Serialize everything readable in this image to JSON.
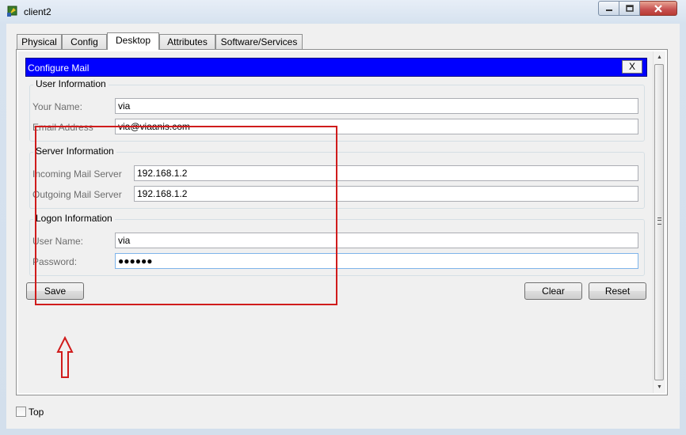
{
  "window": {
    "title": "client2",
    "controls": {
      "minimize": "minimize-icon",
      "maximize": "maximize-icon",
      "close": "close-icon"
    }
  },
  "tabs": [
    {
      "label": "Physical",
      "active": false
    },
    {
      "label": "Config",
      "active": false
    },
    {
      "label": "Desktop",
      "active": true
    },
    {
      "label": "Attributes",
      "active": false
    },
    {
      "label": "Software/Services",
      "active": false
    }
  ],
  "mail": {
    "header_title": "Configure Mail",
    "close_label": "X",
    "user_info": {
      "title": "User Information",
      "name_label": "Your Name:",
      "name_value": "via",
      "email_label": "Email Address",
      "email_value": "via@viaanis.com"
    },
    "server_info": {
      "title": "Server Information",
      "incoming_label": "Incoming Mail Server",
      "incoming_value": "192.168.1.2",
      "outgoing_label": "Outgoing Mail Server",
      "outgoing_value": "192.168.1.2"
    },
    "logon_info": {
      "title": "Logon Information",
      "username_label": "User Name:",
      "username_value": "via",
      "password_label": "Password:",
      "password_value": "●●●●●●"
    },
    "buttons": {
      "save": "Save",
      "clear": "Clear",
      "reset": "Reset"
    }
  },
  "footer": {
    "top_label": "Top",
    "top_checked": false
  },
  "colors": {
    "header_bg": "#0000ff",
    "annotation": "#d01c1c"
  }
}
